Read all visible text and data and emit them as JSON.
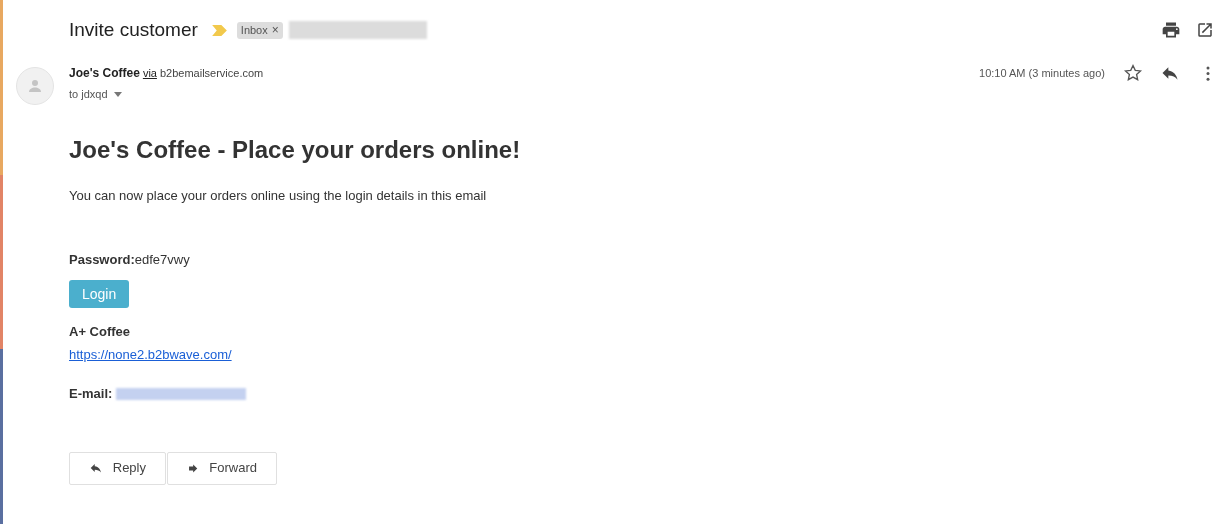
{
  "subject": "Invite customer",
  "label": {
    "text": "Inbox",
    "remove": "×"
  },
  "sender": {
    "name": "Joe's Coffee",
    "via": "via",
    "service": "b2bemailservice.com",
    "to": "to jdxqd"
  },
  "time": "10:10 AM (3 minutes ago)",
  "message": {
    "heading": "Joe's Coffee - Place your orders online!",
    "intro": "You can now place your orders online using the login details in this email",
    "password": "**Password:**edfe7vwy",
    "login_button": "Login",
    "company": "A+ Coffee",
    "link": "https://none2.b2bwave.com/",
    "email_label": "E-mail:"
  },
  "actions": [
    {
      "kind": "reply",
      "label": "Reply"
    },
    {
      "kind": "forward",
      "label": "Forward"
    }
  ]
}
